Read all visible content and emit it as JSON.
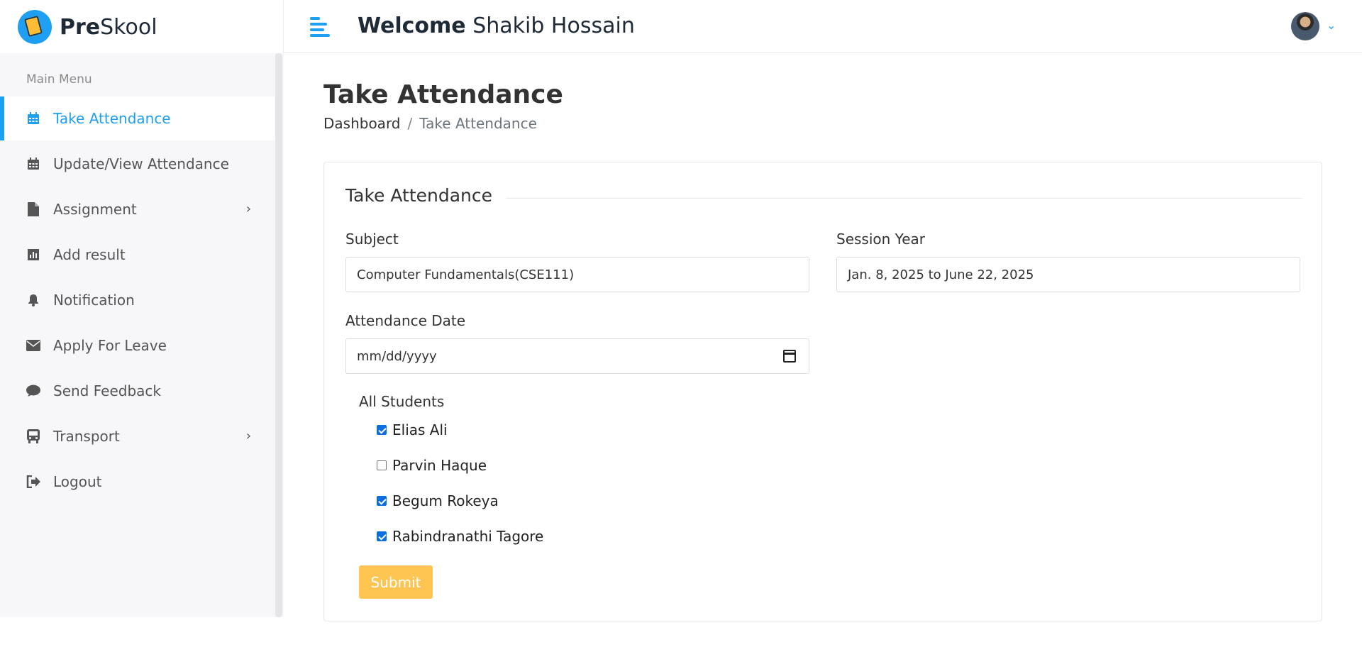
{
  "header": {
    "logo_text_bold": "Pre",
    "logo_text_rest": "Skool",
    "welcome_label": "Welcome",
    "user_name": "Shakib Hossain"
  },
  "sidebar": {
    "menu_title": "Main Menu",
    "items": [
      {
        "label": "Take Attendance",
        "icon": "calendar-icon",
        "active": true
      },
      {
        "label": "Update/View Attendance",
        "icon": "calendar-icon"
      },
      {
        "label": "Assignment",
        "icon": "file-icon",
        "has_submenu": true
      },
      {
        "label": "Add result",
        "icon": "bar-chart-icon"
      },
      {
        "label": "Notification",
        "icon": "bell-icon"
      },
      {
        "label": "Apply For Leave",
        "icon": "envelope-icon"
      },
      {
        "label": "Send Feedback",
        "icon": "comment-icon"
      },
      {
        "label": "Transport",
        "icon": "bus-icon",
        "has_submenu": true
      },
      {
        "label": "Logout",
        "icon": "logout-icon"
      }
    ]
  },
  "page": {
    "title": "Take Attendance",
    "breadcrumb_home": "Dashboard",
    "breadcrumb_sep": "/",
    "breadcrumb_current": "Take Attendance"
  },
  "form": {
    "title": "Take Attendance",
    "subject_label": "Subject",
    "subject_value": "Computer Fundamentals(CSE111)",
    "session_label": "Session Year",
    "session_value": "Jan. 8, 2025 to June 22, 2025",
    "date_label": "Attendance Date",
    "date_placeholder": "mm/dd/yyyy",
    "students_label": "All Students",
    "students": [
      {
        "name": "Elias Ali",
        "checked": true
      },
      {
        "name": "Parvin Haque",
        "checked": false
      },
      {
        "name": "Begum Rokeya",
        "checked": true
      },
      {
        "name": "Rabindranathi Tagore",
        "checked": true
      }
    ],
    "submit_label": "Submit"
  },
  "colors": {
    "accent": "#1e9ff2",
    "submit": "#ffbc34",
    "checkbox": "#0b6ee0"
  }
}
